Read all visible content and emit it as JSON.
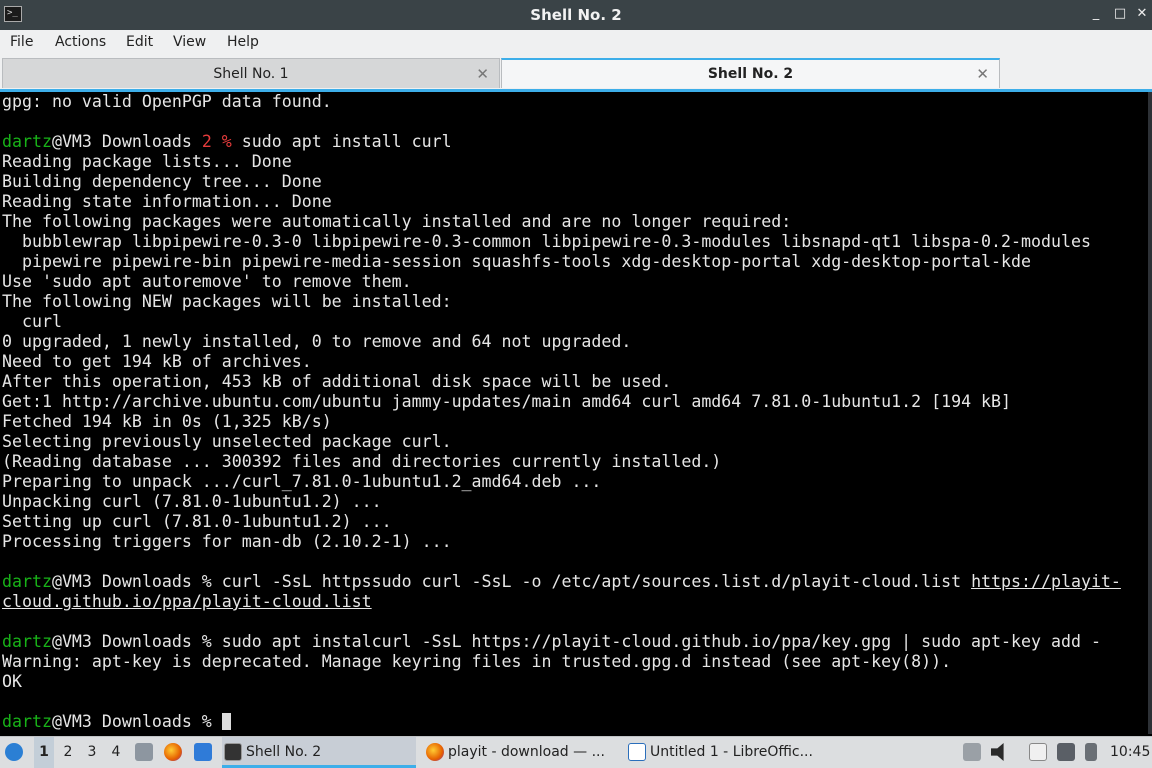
{
  "window": {
    "title": "Shell No. 2",
    "controls": {
      "minimize": "_",
      "restore": "□",
      "close": "✕"
    }
  },
  "menu": [
    "File",
    "Actions",
    "Edit",
    "View",
    "Help"
  ],
  "tabs": [
    {
      "label": "Shell No. 1",
      "close": "✕"
    },
    {
      "label": "Shell No. 2",
      "close": "✕"
    }
  ],
  "terminal": {
    "lines": [
      "gpg: no valid OpenPGP data found.",
      "",
      {
        "user": "dartz",
        "rest": "@VM3 Downloads ",
        "code": "2 %",
        "cmd": " sudo apt install curl"
      },
      "Reading package lists... Done",
      "Building dependency tree... Done",
      "Reading state information... Done",
      "The following packages were automatically installed and are no longer required:",
      "  bubblewrap libpipewire-0.3-0 libpipewire-0.3-common libpipewire-0.3-modules libsnapd-qt1 libspa-0.2-modules",
      "  pipewire pipewire-bin pipewire-media-session squashfs-tools xdg-desktop-portal xdg-desktop-portal-kde",
      "Use 'sudo apt autoremove' to remove them.",
      "The following NEW packages will be installed:",
      "  curl",
      "0 upgraded, 1 newly installed, 0 to remove and 64 not upgraded.",
      "Need to get 194 kB of archives.",
      "After this operation, 453 kB of additional disk space will be used.",
      "Get:1 http://archive.ubuntu.com/ubuntu jammy-updates/main amd64 curl amd64 7.81.0-1ubuntu1.2 [194 kB]",
      "Fetched 194 kB in 0s (1,325 kB/s)",
      "Selecting previously unselected package curl.",
      "(Reading database ... 300392 files and directories currently installed.)",
      "Preparing to unpack .../curl_7.81.0-1ubuntu1.2_amd64.deb ...",
      "Unpacking curl (7.81.0-1ubuntu1.2) ...",
      "Setting up curl (7.81.0-1ubuntu1.2) ...",
      "Processing triggers for man-db (2.10.2-1) ...",
      "",
      {
        "user": "dartz",
        "rest": "@VM3 Downloads % curl -SsL httpssudo curl -SsL -o /etc/apt/sources.list.d/playit-cloud.list ",
        "link": "https://playit-"
      },
      {
        "link": "cloud.github.io/ppa/playit-cloud.list"
      },
      "",
      {
        "user": "dartz",
        "rest": "@VM3 Downloads % sudo apt instalcurl -SsL https://playit-cloud.github.io/ppa/key.gpg | sudo apt-key add -"
      },
      "Warning: apt-key is deprecated. Manage keyring files in trusted.gpg.d instead (see apt-key(8)).",
      "OK",
      "",
      {
        "user": "dartz",
        "rest": "@VM3 Downloads % ",
        "cursor": true
      }
    ]
  },
  "taskbar": {
    "desktops": [
      "1",
      "2",
      "3",
      "4"
    ],
    "tasks": [
      {
        "label": "Shell No. 2",
        "icon": "terminal-icon"
      },
      {
        "label": "playit - download — ...",
        "icon": "firefox-icon"
      },
      {
        "label": "Untitled 1 - LibreOffic...",
        "icon": "libreoffice-writer-icon"
      }
    ],
    "clock": "10:45"
  }
}
